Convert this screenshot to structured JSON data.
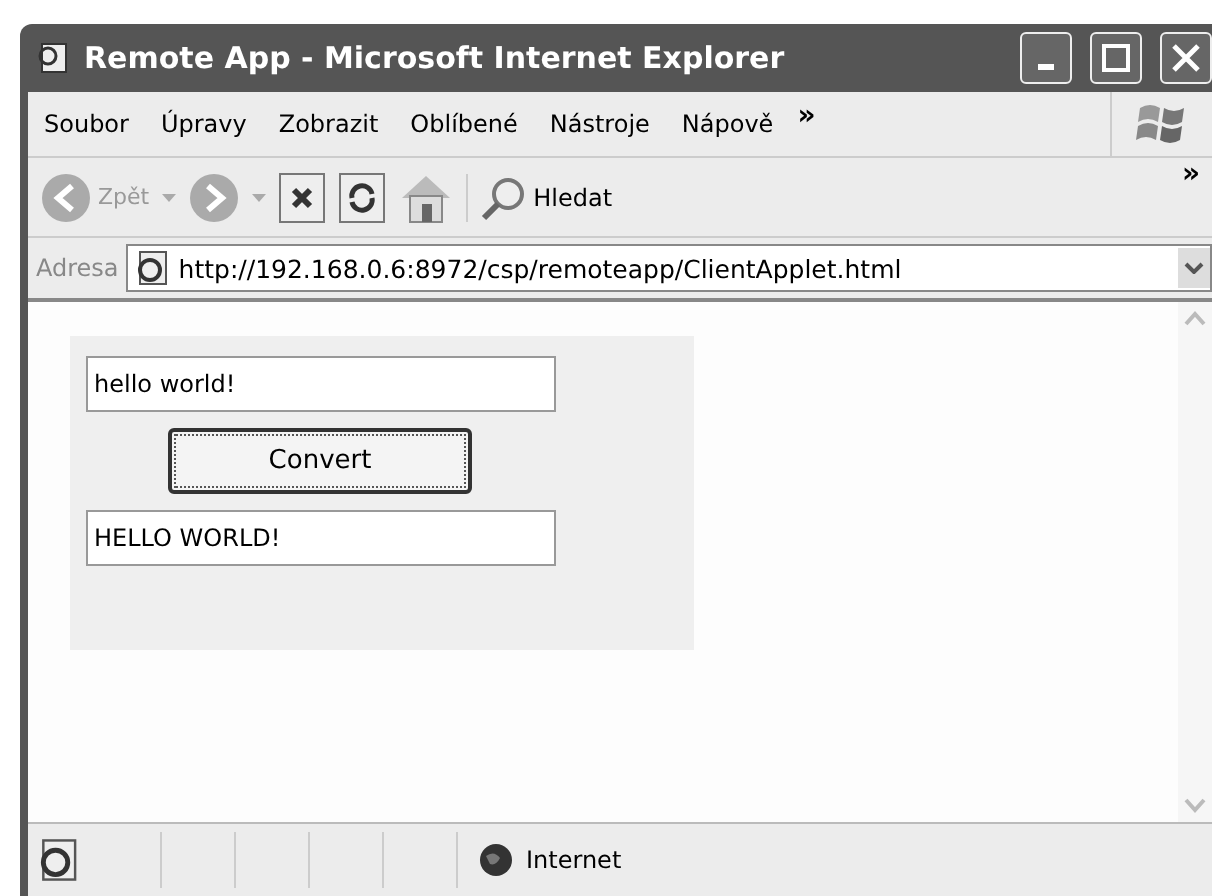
{
  "window": {
    "title": "Remote App - Microsoft Internet Explorer"
  },
  "menu": [
    {
      "label": "Soubor"
    },
    {
      "label": "Úpravy"
    },
    {
      "label": "Zobrazit"
    },
    {
      "label": "Oblíbené"
    },
    {
      "label": "Nástroje"
    },
    {
      "label": "Nápově"
    }
  ],
  "menu_overflow": "»",
  "toolbar": {
    "back": "Zpět",
    "search": "Hledat",
    "overflow": "»"
  },
  "address": {
    "label": "Adresa",
    "url": "http://192.168.0.6:8972/csp/remoteapp/ClientApplet.html"
  },
  "applet": {
    "input": "hello world!",
    "button": "Convert",
    "output": "HELLO WORLD!"
  },
  "status_bar": {
    "zone": "Internet"
  }
}
